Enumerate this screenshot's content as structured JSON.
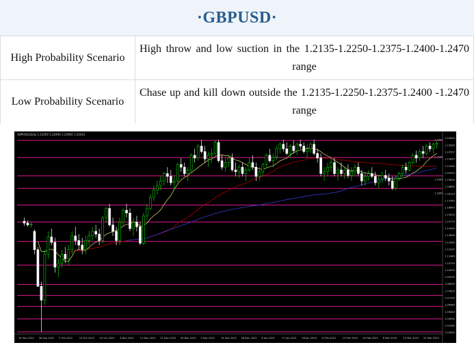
{
  "title": "·GBPUSD·",
  "rows": [
    {
      "label": "High Probability Scenario",
      "text": "High throw and low suction in the 1.2135-1.2250-1.2375-1.2400-1.2470 range"
    },
    {
      "label": "Low Probability Scenario",
      "text": "Chase up and kill down outside the 1.2135-1.2250-1.2375-1.2400 -1.2470 range"
    }
  ],
  "chart_data": {
    "type": "candlestick",
    "header": "GBPUSD,Daily 1.22292 1.22400 1.22065 1.22423",
    "y_ticks": [
      "1.24040",
      "1.23300",
      "1.22557",
      "1.21845",
      "1.21060",
      "1.20350",
      "1.19600",
      "1.18865",
      "1.18110",
      "1.17365",
      "1.16640",
      "1.15920",
      "1.15170",
      "1.14430",
      "1.13690",
      "1.12960",
      "1.12205",
      "1.11480",
      "1.10750",
      "1.10030",
      "1.09295",
      "1.08550",
      "1.07820",
      "1.07100",
      "1.06380",
      "1.05640",
      "1.04900",
      "1.04165",
      "1.03450"
    ],
    "x_ticks": [
      "14 Sep 2022",
      "26 Sep 2022",
      "5 Oct 2022",
      "14 Oct 2022",
      "25 Oct 2022",
      "3 Nov 2022",
      "11 Nov 2022",
      "21 Nov 2022",
      "30 Nov 2022",
      "9 Dec 2022",
      "19 Dec 2022",
      "28 Dec 2022",
      "6 Jan 2023",
      "17 Jan 2023",
      "26 Jan 2023",
      "6 Feb 2023",
      "15 Feb 2023",
      "24 Feb 2023",
      "6 Mar 2023",
      "15 Mar 2023",
      "24 Mar 2023"
    ],
    "price_labels": [
      "1.2432",
      "1.2247",
      "1.2000",
      "1.1850"
    ],
    "colors": {
      "background": "#000000",
      "bull": "#00d000",
      "bear": "#ffffff",
      "level": "#e0188f",
      "ma_fast": "#c8c864",
      "ma_mid": "#b00000",
      "ma_slow": "#3a3ad0"
    },
    "levels": [
      1.2442,
      1.2255,
      1.2055,
      1.1918,
      1.1737,
      1.1552,
      1.134,
      1.1082,
      1.0871,
      1.0751,
      1.0631,
      1.0495,
      1.0353
    ],
    "ohlc": [
      [
        1.156,
        1.16,
        1.151,
        1.154
      ],
      [
        1.154,
        1.157,
        1.15,
        1.152
      ],
      [
        1.152,
        1.1555,
        1.149,
        1.153
      ],
      [
        1.145,
        1.147,
        1.12,
        1.125
      ],
      [
        1.125,
        1.128,
        1.095,
        1.085
      ],
      [
        1.085,
        1.09,
        1.0352,
        1.07
      ],
      [
        1.07,
        1.125,
        1.065,
        1.12
      ],
      [
        1.12,
        1.145,
        1.115,
        1.139
      ],
      [
        1.139,
        1.148,
        1.13,
        1.133
      ],
      [
        1.133,
        1.138,
        1.1,
        1.106
      ],
      [
        1.106,
        1.115,
        1.095,
        1.11
      ],
      [
        1.11,
        1.125,
        1.105,
        1.12
      ],
      [
        1.12,
        1.128,
        1.11,
        1.115
      ],
      [
        1.115,
        1.13,
        1.108,
        1.125
      ],
      [
        1.125,
        1.145,
        1.12,
        1.14
      ],
      [
        1.14,
        1.15,
        1.13,
        1.135
      ],
      [
        1.135,
        1.142,
        1.125,
        1.13
      ],
      [
        1.13,
        1.138,
        1.12,
        1.125
      ],
      [
        1.125,
        1.14,
        1.12,
        1.135
      ],
      [
        1.135,
        1.145,
        1.13,
        1.14
      ],
      [
        1.14,
        1.15,
        1.135,
        1.145
      ],
      [
        1.145,
        1.152,
        1.138,
        1.142
      ],
      [
        1.142,
        1.148,
        1.13,
        1.135
      ],
      [
        1.135,
        1.162,
        1.132,
        1.16
      ],
      [
        1.16,
        1.172,
        1.155,
        1.17
      ],
      [
        1.17,
        1.175,
        1.15,
        1.152
      ],
      [
        1.152,
        1.16,
        1.14,
        1.145
      ],
      [
        1.145,
        1.15,
        1.13,
        1.135
      ],
      [
        1.135,
        1.16,
        1.13,
        1.155
      ],
      [
        1.155,
        1.17,
        1.15,
        1.168
      ],
      [
        1.168,
        1.175,
        1.16,
        1.165
      ],
      [
        1.165,
        1.17,
        1.145,
        1.148
      ],
      [
        1.148,
        1.16,
        1.14,
        1.155
      ],
      [
        1.155,
        1.162,
        1.145,
        1.15
      ],
      [
        1.15,
        1.155,
        1.13,
        1.132
      ],
      [
        1.132,
        1.165,
        1.13,
        1.162
      ],
      [
        1.162,
        1.175,
        1.158,
        1.17
      ],
      [
        1.17,
        1.185,
        1.168,
        1.182
      ],
      [
        1.182,
        1.195,
        1.178,
        1.19
      ],
      [
        1.19,
        1.2,
        1.185,
        1.195
      ],
      [
        1.195,
        1.205,
        1.19,
        1.2
      ],
      [
        1.2,
        1.21,
        1.195,
        1.208
      ],
      [
        1.208,
        1.215,
        1.198,
        1.205
      ],
      [
        1.205,
        1.212,
        1.195,
        1.198
      ],
      [
        1.198,
        1.205,
        1.19,
        1.2
      ],
      [
        1.2,
        1.22,
        1.198,
        1.218
      ],
      [
        1.218,
        1.225,
        1.21,
        1.215
      ],
      [
        1.215,
        1.22,
        1.205,
        1.208
      ],
      [
        1.208,
        1.215,
        1.2,
        1.212
      ],
      [
        1.212,
        1.23,
        1.21,
        1.228
      ],
      [
        1.228,
        1.235,
        1.22,
        1.225
      ],
      [
        1.225,
        1.24,
        1.222,
        1.238
      ],
      [
        1.238,
        1.245,
        1.23,
        1.232
      ],
      [
        1.232,
        1.238,
        1.22,
        1.224
      ],
      [
        1.224,
        1.232,
        1.215,
        1.228
      ],
      [
        1.228,
        1.235,
        1.22,
        1.23
      ],
      [
        1.23,
        1.244,
        1.228,
        1.242
      ],
      [
        1.242,
        1.245,
        1.22,
        1.222
      ],
      [
        1.222,
        1.228,
        1.212,
        1.215
      ],
      [
        1.215,
        1.225,
        1.21,
        1.22
      ],
      [
        1.22,
        1.228,
        1.215,
        1.225
      ],
      [
        1.225,
        1.23,
        1.21,
        1.212
      ],
      [
        1.212,
        1.22,
        1.205,
        1.21
      ],
      [
        1.21,
        1.218,
        1.203,
        1.215
      ],
      [
        1.215,
        1.22,
        1.205,
        1.208
      ],
      [
        1.208,
        1.215,
        1.2,
        1.212
      ],
      [
        1.212,
        1.225,
        1.21,
        1.22
      ],
      [
        1.22,
        1.228,
        1.212,
        1.215
      ],
      [
        1.215,
        1.22,
        1.2,
        1.205
      ],
      [
        1.205,
        1.215,
        1.2,
        1.21
      ],
      [
        1.21,
        1.22,
        1.205,
        1.218
      ],
      [
        1.218,
        1.23,
        1.215,
        1.228
      ],
      [
        1.228,
        1.235,
        1.22,
        1.222
      ],
      [
        1.222,
        1.23,
        1.215,
        1.226
      ],
      [
        1.226,
        1.238,
        1.223,
        1.235
      ],
      [
        1.235,
        1.242,
        1.23,
        1.24
      ],
      [
        1.24,
        1.245,
        1.232,
        1.235
      ],
      [
        1.235,
        1.242,
        1.228,
        1.23
      ],
      [
        1.23,
        1.24,
        1.225,
        1.238
      ],
      [
        1.238,
        1.244,
        1.23,
        1.233
      ],
      [
        1.233,
        1.242,
        1.228,
        1.24
      ],
      [
        1.24,
        1.245,
        1.235,
        1.238
      ],
      [
        1.238,
        1.242,
        1.23,
        1.232
      ],
      [
        1.232,
        1.24,
        1.225,
        1.235
      ],
      [
        1.235,
        1.242,
        1.23,
        1.24
      ],
      [
        1.24,
        1.245,
        1.228,
        1.23
      ],
      [
        1.23,
        1.235,
        1.22,
        1.225
      ],
      [
        1.225,
        1.23,
        1.205,
        1.208
      ],
      [
        1.208,
        1.215,
        1.2,
        1.21
      ],
      [
        1.21,
        1.22,
        1.205,
        1.215
      ],
      [
        1.215,
        1.225,
        1.21,
        1.22
      ],
      [
        1.22,
        1.225,
        1.205,
        1.208
      ],
      [
        1.208,
        1.215,
        1.2,
        1.212
      ],
      [
        1.212,
        1.22,
        1.205,
        1.208
      ],
      [
        1.208,
        1.215,
        1.202,
        1.212
      ],
      [
        1.212,
        1.218,
        1.203,
        1.206
      ],
      [
        1.206,
        1.215,
        1.2,
        1.21
      ],
      [
        1.21,
        1.218,
        1.205,
        1.215
      ],
      [
        1.215,
        1.22,
        1.205,
        1.208
      ],
      [
        1.208,
        1.212,
        1.195,
        1.2
      ],
      [
        1.2,
        1.21,
        1.195,
        1.205
      ],
      [
        1.205,
        1.212,
        1.2,
        1.208
      ],
      [
        1.208,
        1.215,
        1.203,
        1.205
      ],
      [
        1.205,
        1.21,
        1.195,
        1.198
      ],
      [
        1.198,
        1.205,
        1.192,
        1.202
      ],
      [
        1.202,
        1.21,
        1.198,
        1.206
      ],
      [
        1.206,
        1.212,
        1.2,
        1.203
      ],
      [
        1.203,
        1.208,
        1.195,
        1.2
      ],
      [
        1.2,
        1.205,
        1.19,
        1.192
      ],
      [
        1.192,
        1.205,
        1.19,
        1.203
      ],
      [
        1.203,
        1.21,
        1.2,
        1.208
      ],
      [
        1.208,
        1.218,
        1.205,
        1.215
      ],
      [
        1.215,
        1.22,
        1.208,
        1.212
      ],
      [
        1.212,
        1.222,
        1.21,
        1.22
      ],
      [
        1.22,
        1.23,
        1.218,
        1.228
      ],
      [
        1.228,
        1.233,
        1.22,
        1.225
      ],
      [
        1.225,
        1.235,
        1.222,
        1.232
      ],
      [
        1.232,
        1.238,
        1.225,
        1.23
      ],
      [
        1.23,
        1.24,
        1.228,
        1.238
      ],
      [
        1.238,
        1.242,
        1.232,
        1.235
      ],
      [
        1.235,
        1.242,
        1.23,
        1.24
      ],
      [
        1.24,
        1.244,
        1.235,
        1.241
      ]
    ]
  }
}
